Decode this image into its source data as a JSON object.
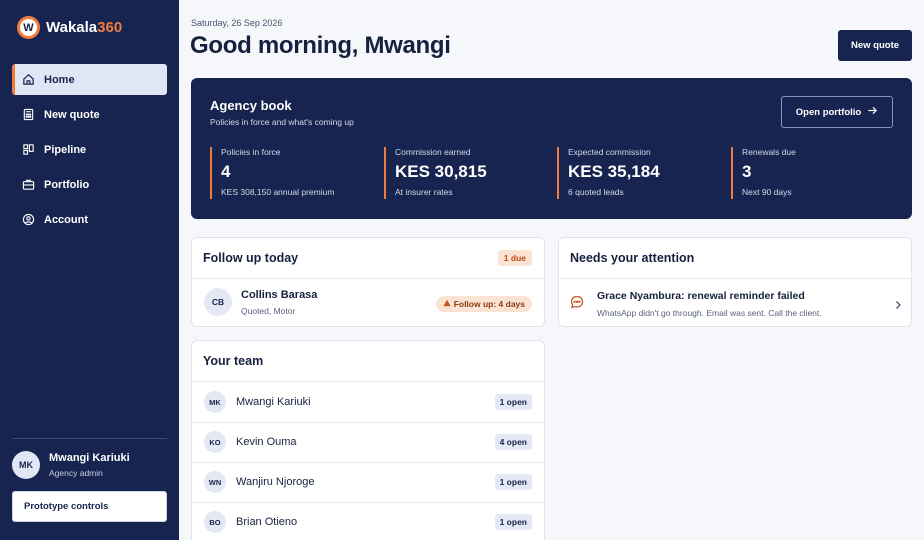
{
  "brand": {
    "logo_letter": "W",
    "name_main": "Wakala",
    "name_accent": "360"
  },
  "nav": [
    {
      "label": "Home",
      "icon": "home-icon",
      "active": true
    },
    {
      "label": "New quote",
      "icon": "calculator-icon"
    },
    {
      "label": "Pipeline",
      "icon": "kanban-icon"
    },
    {
      "label": "Portfolio",
      "icon": "briefcase-icon"
    },
    {
      "label": "Account",
      "icon": "user-circle-icon"
    }
  ],
  "user": {
    "initials": "MK",
    "name": "Mwangi Kariuki",
    "role": "Agency admin"
  },
  "prototype_controls": "Prototype controls",
  "header": {
    "date": "Saturday, 26 Sep 2026",
    "greeting": "Good morning, Mwangi",
    "new_quote": "New quote"
  },
  "agency": {
    "title": "Agency book",
    "subtitle": "Policies in force and what's coming up",
    "open_portfolio": "Open portfolio",
    "stats": [
      {
        "label": "Policies in force",
        "value": "4",
        "note": "KES 308,150 annual premium"
      },
      {
        "label": "Commission earned",
        "value": "KES 30,815",
        "note": "At insurer rates"
      },
      {
        "label": "Expected commission",
        "value": "KES 35,184",
        "note": "6 quoted leads"
      },
      {
        "label": "Renewals due",
        "value": "3",
        "note": "Next 90 days"
      }
    ]
  },
  "follow_up": {
    "title": "Follow up today",
    "badge": "1 due",
    "items": [
      {
        "initials": "CB",
        "name": "Collins Barasa",
        "meta": "Quoted, Motor",
        "pill": "Follow up: 4 days"
      }
    ]
  },
  "attention": {
    "title": "Needs your attention",
    "items": [
      {
        "title": "Grace Nyambura: renewal reminder failed",
        "desc": "WhatsApp didn't go through. Email was sent. Call the client."
      }
    ]
  },
  "team": {
    "title": "Your team",
    "members": [
      {
        "initials": "MK",
        "name": "Mwangi Kariuki",
        "open": "1 open"
      },
      {
        "initials": "KO",
        "name": "Kevin Ouma",
        "open": "4 open"
      },
      {
        "initials": "WN",
        "name": "Wanjiru Njoroge",
        "open": "1 open"
      },
      {
        "initials": "BO",
        "name": "Brian Otieno",
        "open": "1 open"
      }
    ]
  },
  "colors": {
    "navy": "#16244f",
    "accent": "#f07b3f",
    "background": "#f6f7fa"
  }
}
